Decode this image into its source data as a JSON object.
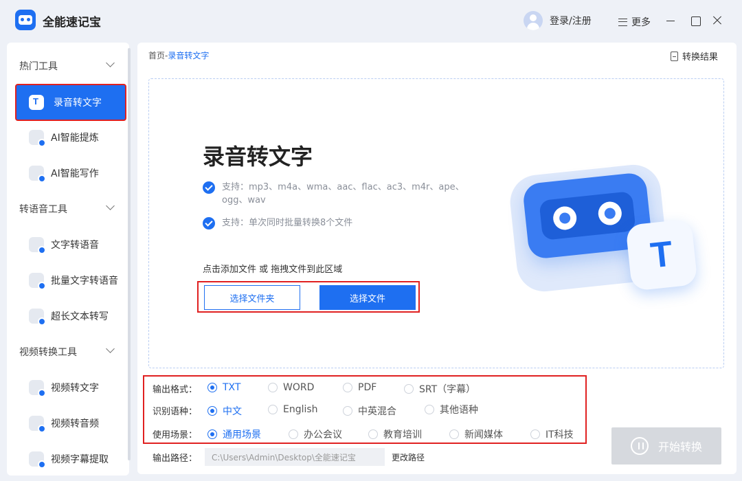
{
  "app": {
    "title": "全能速记宝"
  },
  "header": {
    "login_label": "登录/注册",
    "more_label": "更多"
  },
  "sidebar": {
    "groups": [
      {
        "label": "热门工具",
        "items": [
          "录音转文字",
          "AI智能提炼",
          "AI智能写作"
        ]
      },
      {
        "label": "转语音工具",
        "items": [
          "文字转语音",
          "批量文字转语音",
          "超长文本转写"
        ]
      },
      {
        "label": "视频转换工具",
        "items": [
          "视频转文字",
          "视频转音频",
          "视频字幕提取"
        ]
      }
    ],
    "active_item": "录音转文字"
  },
  "main": {
    "breadcrumb": {
      "home": "首页",
      "separator": "-",
      "current": "录音转文字"
    },
    "result_label": "转换结果",
    "hero_title": "录音转文字",
    "features": [
      "支持：mp3、m4a、wma、aac、flac、ac3、m4r、ape、ogg、wav",
      "支持：单次同时批量转换8个文件"
    ],
    "drop_hint": "点击添加文件 或 拖拽文件到此区域",
    "btn_folder": "选择文件夹",
    "btn_file": "选择文件",
    "options": {
      "format": {
        "label": "输出格式：",
        "choices": [
          "TXT",
          "WORD",
          "PDF",
          "SRT（字幕）"
        ],
        "selected": "TXT"
      },
      "language": {
        "label": "识别语种：",
        "choices": [
          "中文",
          "English",
          "中英混合",
          "其他语种"
        ],
        "selected": "中文"
      },
      "scene": {
        "label": "使用场景：",
        "choices": [
          "通用场景",
          "办公会议",
          "教育培训",
          "新闻媒体",
          "IT科技"
        ],
        "selected": "通用场景"
      }
    },
    "output_path": {
      "label": "输出路径：",
      "value": "C:\\Users\\Admin\\Desktop\\全能速记宝",
      "change_label": "更改路径"
    },
    "start_label": "开始转换"
  },
  "colors": {
    "accent": "#1e6ff1",
    "highlight_border": "#e02020",
    "disabled": "#d6d9de"
  }
}
